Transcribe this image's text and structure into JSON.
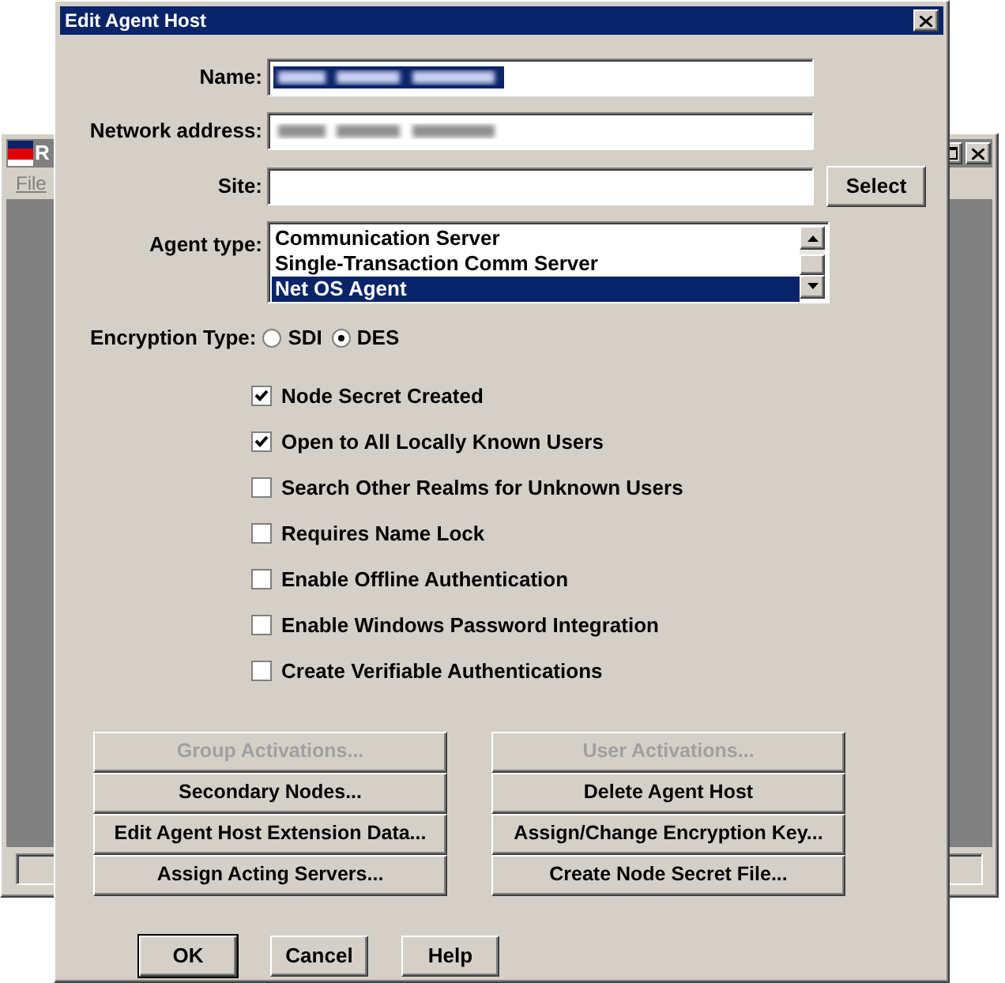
{
  "background_window": {
    "title": "R",
    "menu": [
      "File"
    ]
  },
  "dialog": {
    "title": "Edit Agent Host",
    "fields": [
      {
        "label": "Name:",
        "kind": "blurred",
        "text_selected": true
      },
      {
        "label": "Network address:",
        "kind": "blurred",
        "text_selected": false
      },
      {
        "label": "Site:",
        "kind": "empty"
      }
    ],
    "select_button": "Select",
    "agent_type": {
      "label": "Agent type:",
      "items": [
        {
          "label": "Communication Server",
          "selected": false
        },
        {
          "label": "Single-Transaction Comm Server",
          "selected": false
        },
        {
          "label": "Net OS Agent",
          "selected": true
        }
      ]
    },
    "encryption": {
      "label": "Encryption Type:",
      "options": [
        {
          "label": "SDI",
          "selected": false
        },
        {
          "label": "DES",
          "selected": true
        }
      ]
    },
    "checkboxes": [
      {
        "label": "Node Secret Created",
        "checked": true
      },
      {
        "label": "Open to All Locally Known Users",
        "checked": true
      },
      {
        "label": "Search Other Realms for Unknown Users",
        "checked": false
      },
      {
        "label": "Requires Name Lock",
        "checked": false
      },
      {
        "label": "Enable Offline Authentication",
        "checked": false
      },
      {
        "label": "Enable Windows Password Integration",
        "checked": false
      },
      {
        "label": "Create Verifiable Authentications",
        "checked": false
      }
    ],
    "action_buttons": [
      {
        "label": "Group Activations...",
        "disabled": true
      },
      {
        "label": "User Activations...",
        "disabled": true
      },
      {
        "label": "Secondary Nodes...",
        "disabled": false
      },
      {
        "label": "Delete Agent Host",
        "disabled": false
      },
      {
        "label": "Edit Agent Host Extension Data...",
        "disabled": false
      },
      {
        "label": "Assign/Change Encryption Key...",
        "disabled": false
      },
      {
        "label": "Assign Acting Servers...",
        "disabled": false
      },
      {
        "label": "Create Node Secret File...",
        "disabled": false
      }
    ],
    "footer_buttons": [
      {
        "label": "OK",
        "default": true
      },
      {
        "label": "Cancel",
        "default": false
      },
      {
        "label": "Help",
        "default": false
      }
    ]
  }
}
